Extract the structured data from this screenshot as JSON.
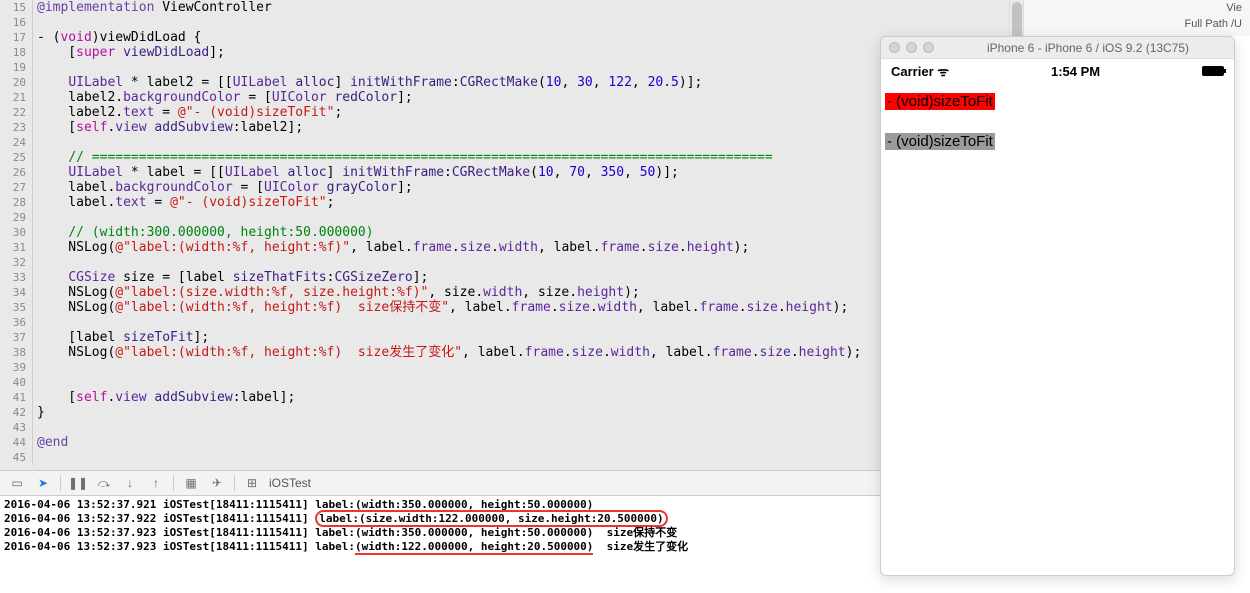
{
  "rightPanel": {
    "a": "Vie",
    "b": "Full Path   /U"
  },
  "sim": {
    "title": "iPhone 6 - iPhone 6 / iOS 9.2 (13C75)",
    "carrier": "Carrier  ᯤ",
    "time": "1:54 PM",
    "labelA": "- (void)sizeToFit",
    "labelB": "- (void)sizeToFit"
  },
  "debugbar": {
    "target": "iOSTest"
  },
  "gutter": [
    "15",
    "16",
    "17",
    "18",
    "19",
    "20",
    "21",
    "22",
    "23",
    "24",
    "25",
    "26",
    "27",
    "28",
    "29",
    "30",
    "31",
    "32",
    "33",
    "34",
    "35",
    "36",
    "37",
    "38",
    "39",
    "40",
    "41",
    "42",
    "43",
    "44",
    "45"
  ],
  "code": {
    "l15": {
      "a": "@implementation",
      "b": " ViewController"
    },
    "l17": {
      "a": "- (",
      "b": "void",
      "c": ")viewDidLoad {"
    },
    "l18": {
      "a": "    [",
      "b": "super",
      "c": " ",
      "d": "viewDidLoad",
      "e": "];"
    },
    "l20": {
      "a": "    ",
      "t1": "UILabel",
      "b": " * label2 = [[",
      "t2": "UILabel",
      "c": " ",
      "m1": "alloc",
      "d": "] ",
      "m2": "initWithFrame",
      "e": ":",
      "m3": "CGRectMake",
      "f": "(",
      "n1": "10",
      "g": ", ",
      "n2": "30",
      "h": ", ",
      "n3": "122",
      "i": ", ",
      "n4": "20.5",
      "j": ")];"
    },
    "l21": {
      "a": "    label2.",
      "p": "backgroundColor",
      "b": " = [",
      "t": "UIColor",
      "c": " ",
      "m": "redColor",
      "d": "];"
    },
    "l22": {
      "a": "    label2.",
      "p": "text",
      "b": " = ",
      "s": "@\"- (void)sizeToFit\"",
      "c": ";"
    },
    "l23": {
      "a": "    [",
      "s": "self",
      "b": ".",
      "p": "view",
      "c": " ",
      "m": "addSubview",
      "d": ":label2];"
    },
    "l25": {
      "a": "    ",
      "c": "// ======================================================================================="
    },
    "l26": {
      "a": "    ",
      "t1": "UILabel",
      "b": " * label = [[",
      "t2": "UILabel",
      "c": " ",
      "m1": "alloc",
      "d": "] ",
      "m2": "initWithFrame",
      "e": ":",
      "m3": "CGRectMake",
      "f": "(",
      "n1": "10",
      "g": ", ",
      "n2": "70",
      "h": ", ",
      "n3": "350",
      "i": ", ",
      "n4": "50",
      "j": ")];"
    },
    "l27": {
      "a": "    label.",
      "p": "backgroundColor",
      "b": " = [",
      "t": "UIColor",
      "c": " ",
      "m": "grayColor",
      "d": "];"
    },
    "l28": {
      "a": "    label.",
      "p": "text",
      "b": " = ",
      "s": "@\"- (void)sizeToFit\"",
      "c": ";"
    },
    "l30": {
      "a": "    ",
      "c": "// (width:300.000000, height:50.000000)"
    },
    "l31": {
      "a": "    NSLog(",
      "s": "@\"label:(width:%f, height:%f)\"",
      "b": ", label.",
      "p1": "frame",
      "c": ".",
      "p2": "size",
      "d": ".",
      "p3": "width",
      "e": ", label.",
      "p4": "frame",
      "f": ".",
      "p5": "size",
      "g": ".",
      "p6": "height",
      "h": ");"
    },
    "l33": {
      "a": "    ",
      "t": "CGSize",
      "b": " size = [label ",
      "m": "sizeThatFits",
      "c": ":",
      "t2": "CGSizeZero",
      "d": "];"
    },
    "l34": {
      "a": "    NSLog(",
      "s": "@\"label:(size.width:%f, size.height:%f)\"",
      "b": ", size.",
      "p1": "width",
      "c": ", size.",
      "p2": "height",
      "d": ");"
    },
    "l35": {
      "a": "    NSLog(",
      "s": "@\"label:(width:%f, height:%f)  size保持不变\"",
      "b": ", label.",
      "p1": "frame",
      "c": ".",
      "p2": "size",
      "d": ".",
      "p3": "width",
      "e": ", label.",
      "p4": "frame",
      "f": ".",
      "p5": "size",
      "g": ".",
      "p6": "height",
      "h": ");"
    },
    "l37": {
      "a": "    [label ",
      "m": "sizeToFit",
      "b": "];"
    },
    "l38": {
      "a": "    NSLog(",
      "s": "@\"label:(width:%f, height:%f)  size发生了变化\"",
      "b": ", label.",
      "p1": "frame",
      "c": ".",
      "p2": "size",
      "d": ".",
      "p3": "width",
      "e": ", label.",
      "p4": "frame",
      "f": ".",
      "p5": "size",
      "g": ".",
      "p6": "height",
      "h": ");"
    },
    "l41": {
      "a": "    [",
      "s": "self",
      "b": ".",
      "p": "view",
      "c": " ",
      "m": "addSubview",
      "d": ":label];"
    },
    "l42": {
      "a": "}"
    },
    "l44": {
      "a": "@end"
    }
  },
  "console": [
    {
      "pre": "2016-04-06 13:52:37.921 iOSTest[18411:1115411] ",
      "msg": "label:(width:350.000000, height:50.000000)",
      "post": ""
    },
    {
      "pre": "2016-04-06 13:52:37.922 iOSTest[18411:1115411] ",
      "msg": "label:(size.width:122.000000, size.height:20.500000)",
      "post": ""
    },
    {
      "pre": "2016-04-06 13:52:37.923 iOSTest[18411:1115411] ",
      "msg": "label:(width:350.000000, height:50.000000)",
      "post": "  size保持不变"
    },
    {
      "pre": "2016-04-06 13:52:37.923 iOSTest[18411:1115411] ",
      "msg": "label:",
      "post": "  size发生了变化",
      "und": "(width:122.000000, height:20.500000)"
    }
  ]
}
